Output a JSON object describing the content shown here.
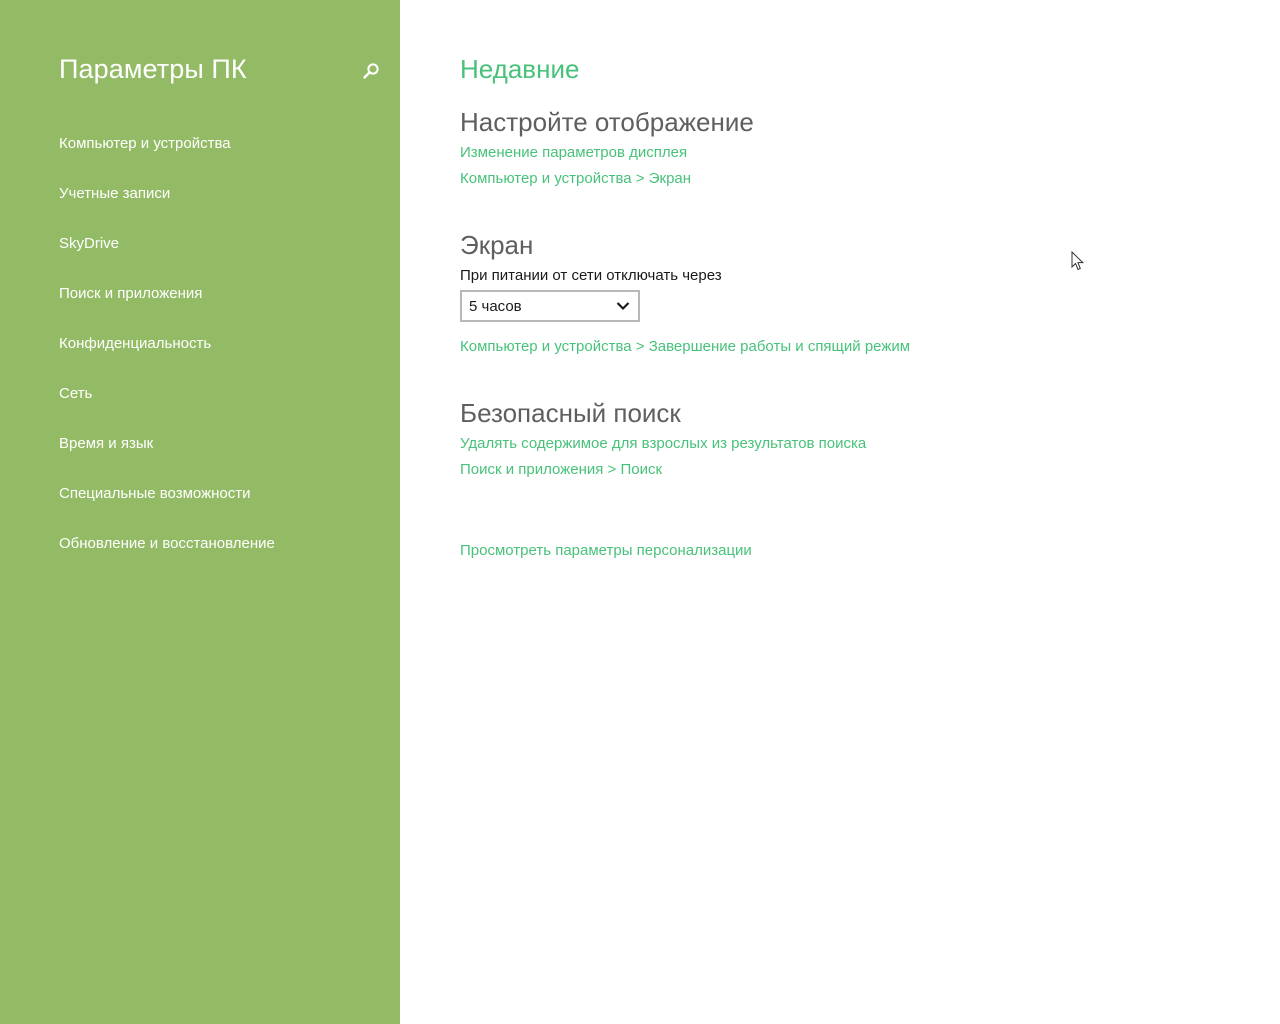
{
  "sidebar": {
    "title": "Параметры ПК",
    "search_icon": "search-icon",
    "items": [
      {
        "label": "Компьютер и устройства"
      },
      {
        "label": "Учетные записи"
      },
      {
        "label": "SkyDrive"
      },
      {
        "label": "Поиск и приложения"
      },
      {
        "label": "Конфиденциальность"
      },
      {
        "label": "Сеть"
      },
      {
        "label": "Время и язык"
      },
      {
        "label": "Специальные возможности"
      },
      {
        "label": "Обновление и восстановление"
      }
    ]
  },
  "main": {
    "section_title": "Недавние",
    "display": {
      "heading": "Настройте отображение",
      "link": "Изменение параметров дисплея",
      "path": "Компьютер и устройства > Экран"
    },
    "screen": {
      "heading": "Экран",
      "label": "При питании от сети отключать через",
      "select_value": "5 часов",
      "path": "Компьютер и устройства > Завершение работы и спящий режим"
    },
    "safe_search": {
      "heading": "Безопасный поиск",
      "link": "Удалять содержимое для взрослых из результатов поиска",
      "path": "Поиск и приложения > Поиск"
    },
    "personalization_link": "Просмотреть параметры персонализации"
  },
  "colors": {
    "sidebar_bg": "#93bb66",
    "accent_link": "#48c27a",
    "heading_text": "#5f5f5f"
  }
}
